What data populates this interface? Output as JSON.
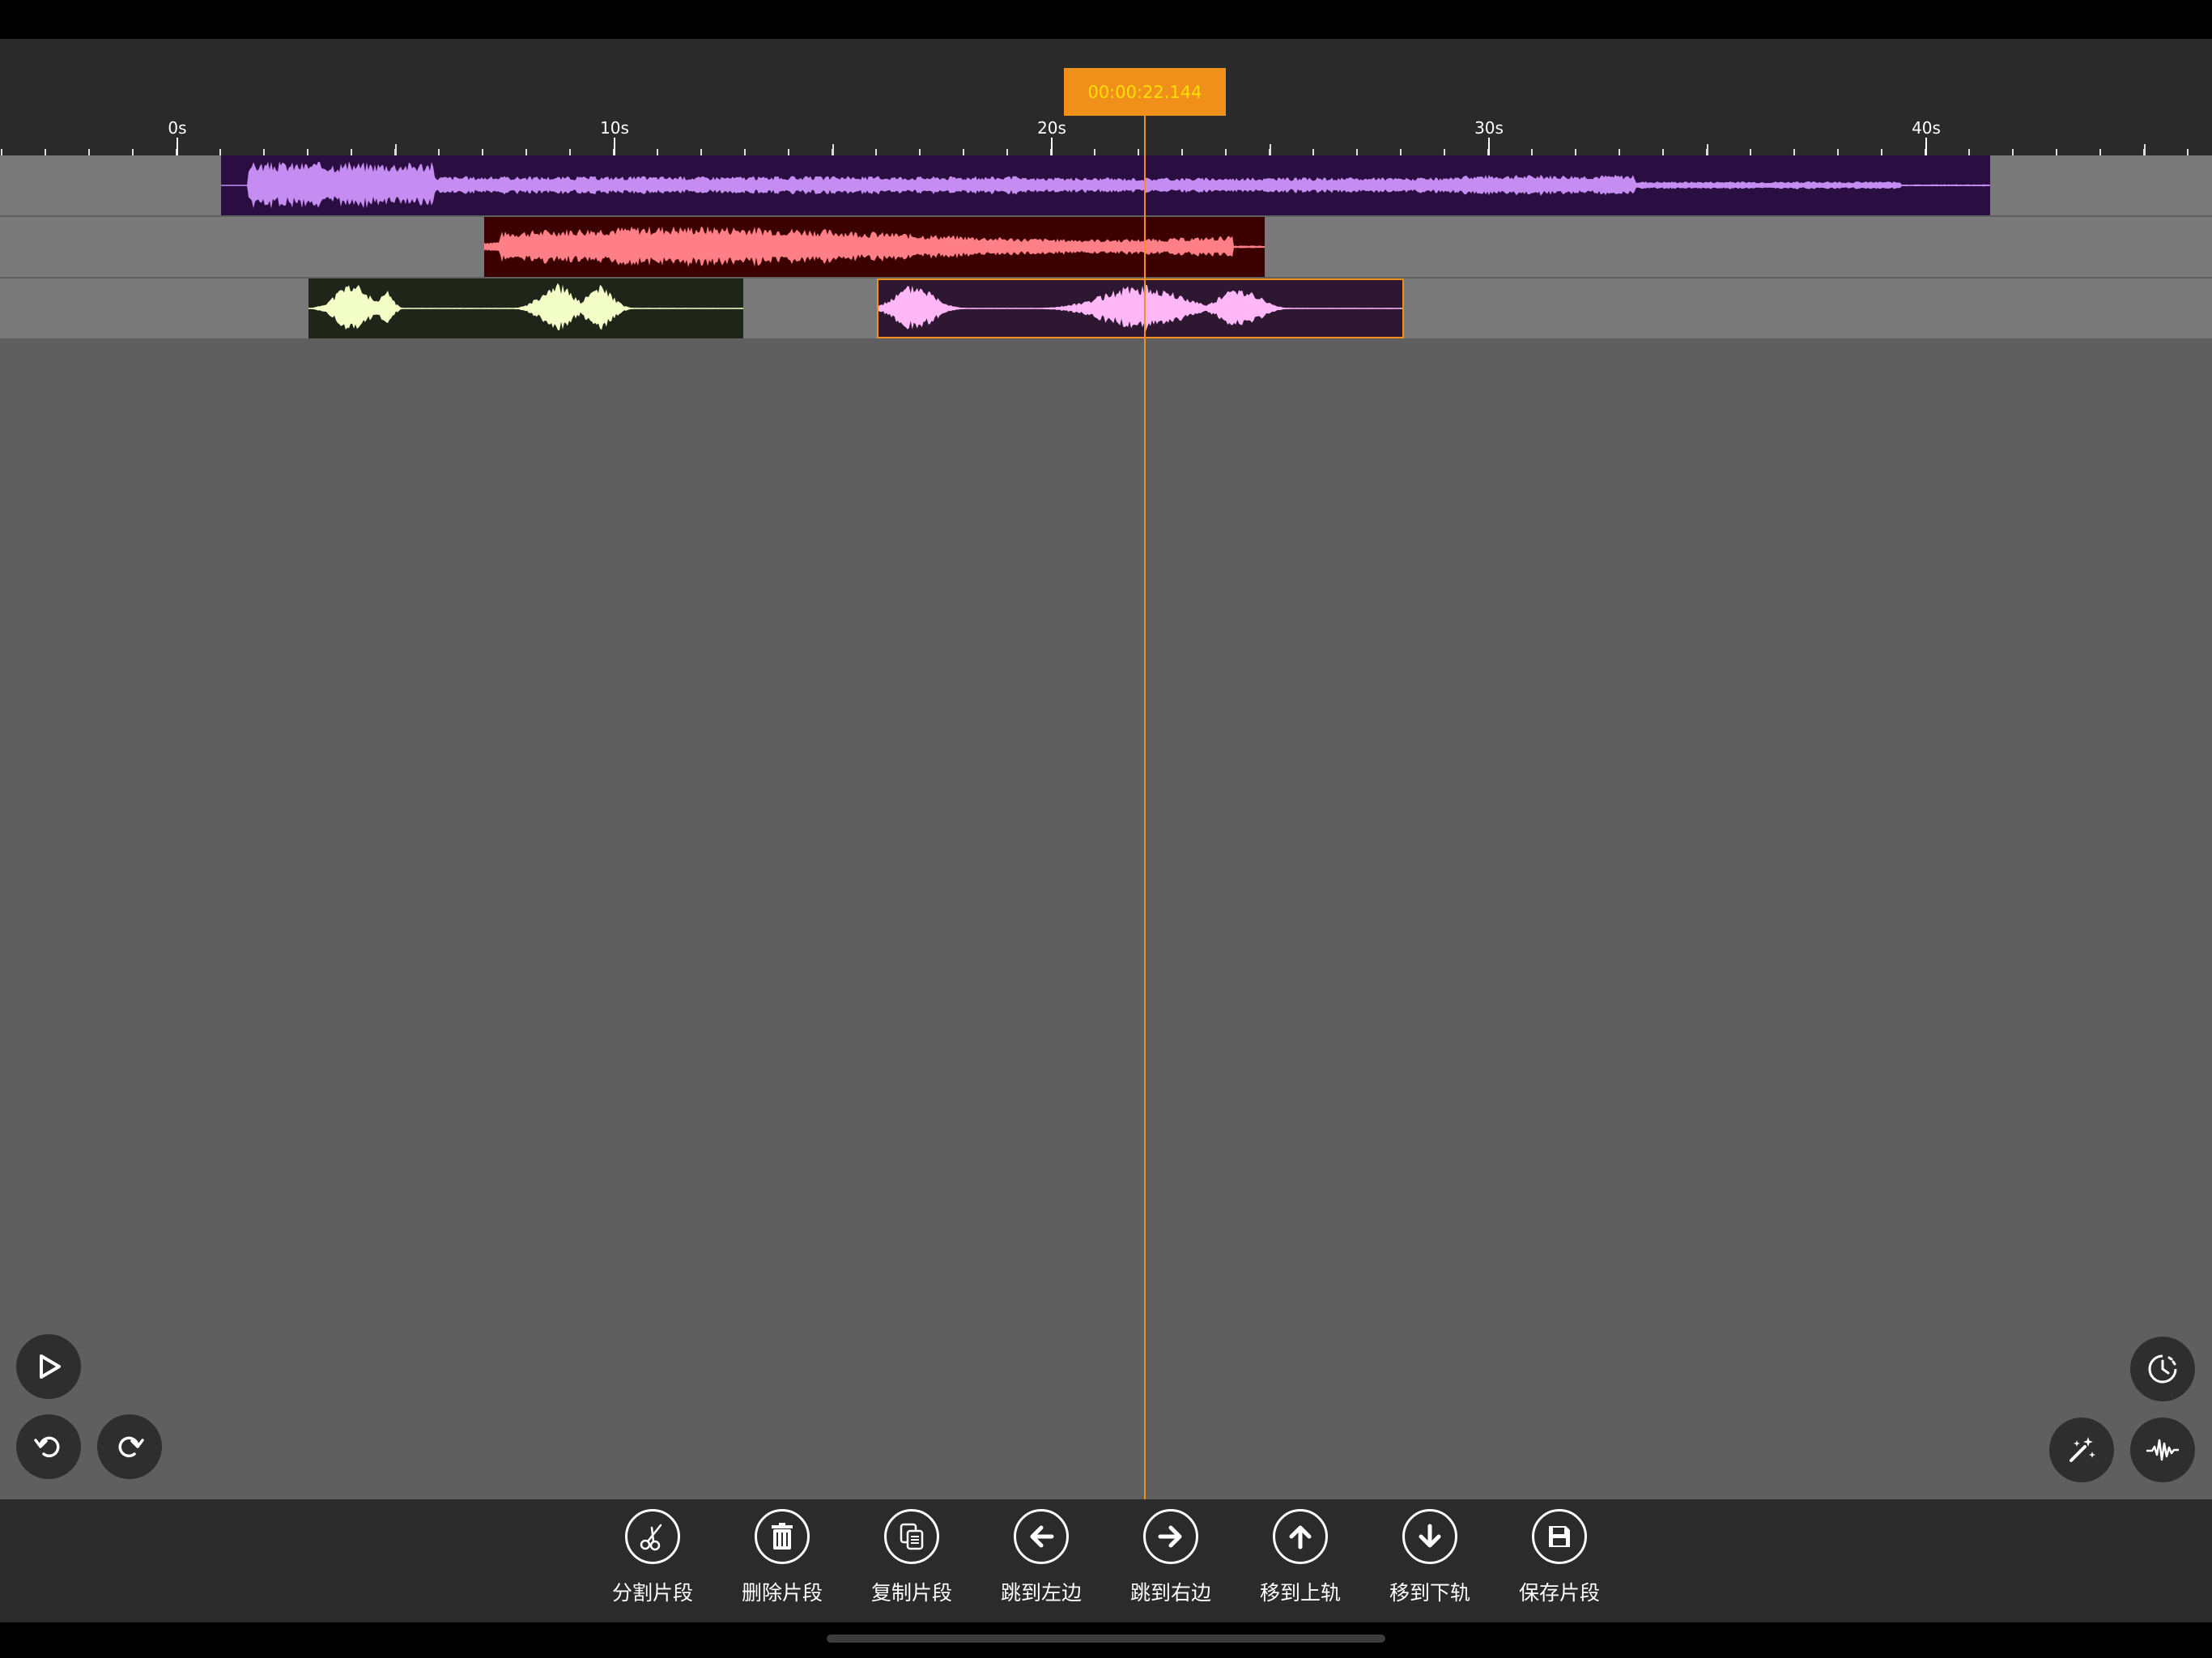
{
  "timeline": {
    "playhead_time": "00:00:22.144",
    "tick_labels": [
      "0s",
      "10s",
      "20s",
      "30s",
      "40s"
    ]
  },
  "tracks": [
    {
      "clips": [
        {
          "color": "#2a0e42",
          "wave": "#c58cf2"
        }
      ]
    },
    {
      "clips": [
        {
          "color": "#3d0000",
          "wave": "#ff7f86"
        }
      ]
    },
    {
      "clips": [
        {
          "color": "#20251a",
          "wave": "#f4ffc8"
        },
        {
          "color": "#2e1730",
          "wave": "#ffb7f8"
        }
      ]
    }
  ],
  "colors": {
    "accent": "#f0901b",
    "playhead_text": "#ffe000"
  },
  "controls": {
    "left": [
      "play-icon",
      "undo-icon",
      "redo-icon"
    ],
    "right": [
      "clock-icon",
      "magic-wand-icon",
      "waveform-icon"
    ]
  },
  "toolbar": {
    "split": "分割片段",
    "delete": "删除片段",
    "copy": "复制片段",
    "jump_left": "跳到左边",
    "jump_right": "跳到右边",
    "move_up": "移到上轨",
    "move_down": "移到下轨",
    "save": "保存片段"
  }
}
